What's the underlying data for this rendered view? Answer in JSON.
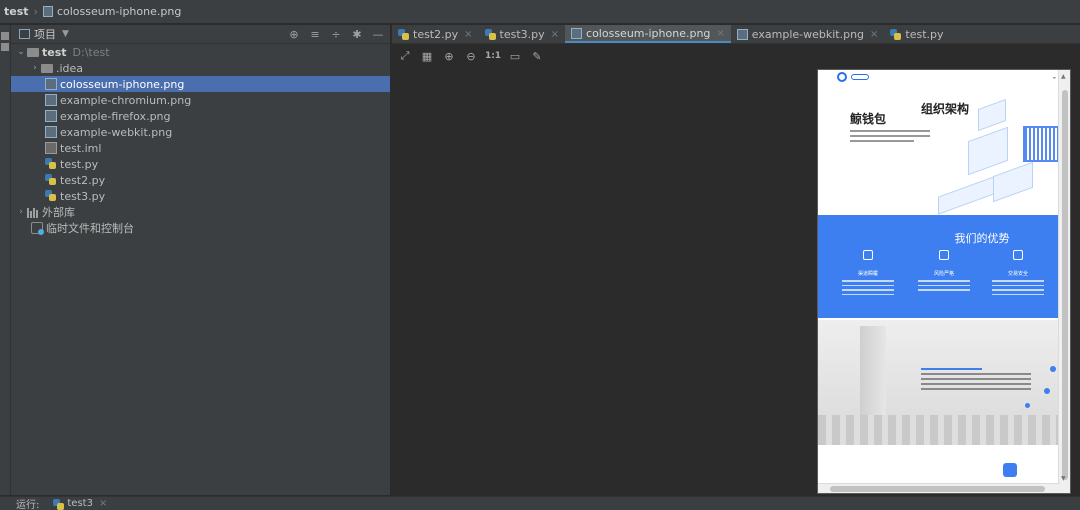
{
  "breadcrumb": {
    "root": "test",
    "file": "colosseum-iphone.png"
  },
  "project_panel": {
    "title": "项目",
    "tools": [
      "locate-icon",
      "expand-all-icon",
      "collapse-all-icon",
      "gear-icon",
      "hide-icon"
    ],
    "tree": {
      "root": {
        "name": "test",
        "path": "D:\\test"
      },
      "items": [
        {
          "label": ".idea",
          "type": "folder"
        },
        {
          "label": "colosseum-iphone.png",
          "type": "png",
          "selected": true
        },
        {
          "label": "example-chromium.png",
          "type": "png"
        },
        {
          "label": "example-firefox.png",
          "type": "png"
        },
        {
          "label": "example-webkit.png",
          "type": "png"
        },
        {
          "label": "test.iml",
          "type": "iml"
        },
        {
          "label": "test.py",
          "type": "py"
        },
        {
          "label": "test2.py",
          "type": "py"
        },
        {
          "label": "test3.py",
          "type": "py"
        }
      ],
      "external_libs": "外部库",
      "scratches": "临时文件和控制台"
    }
  },
  "tabs": [
    {
      "label": "test2.py",
      "type": "py"
    },
    {
      "label": "test3.py",
      "type": "py"
    },
    {
      "label": "colosseum-iphone.png",
      "type": "png",
      "active": true
    },
    {
      "label": "example-webkit.png",
      "type": "png"
    },
    {
      "label": "test.py",
      "type": "py"
    }
  ],
  "viewer_toolbar": {
    "actual_size": "1:1"
  },
  "phone_image": {
    "hero_title": "鲸钱包",
    "advantages_title": "我们的优势",
    "features": [
      "渠道瞬覆",
      "风险严格",
      "交易安全"
    ],
    "org_title": "组织架构"
  },
  "run_bar": {
    "label": "运行:",
    "tab": "test3"
  }
}
